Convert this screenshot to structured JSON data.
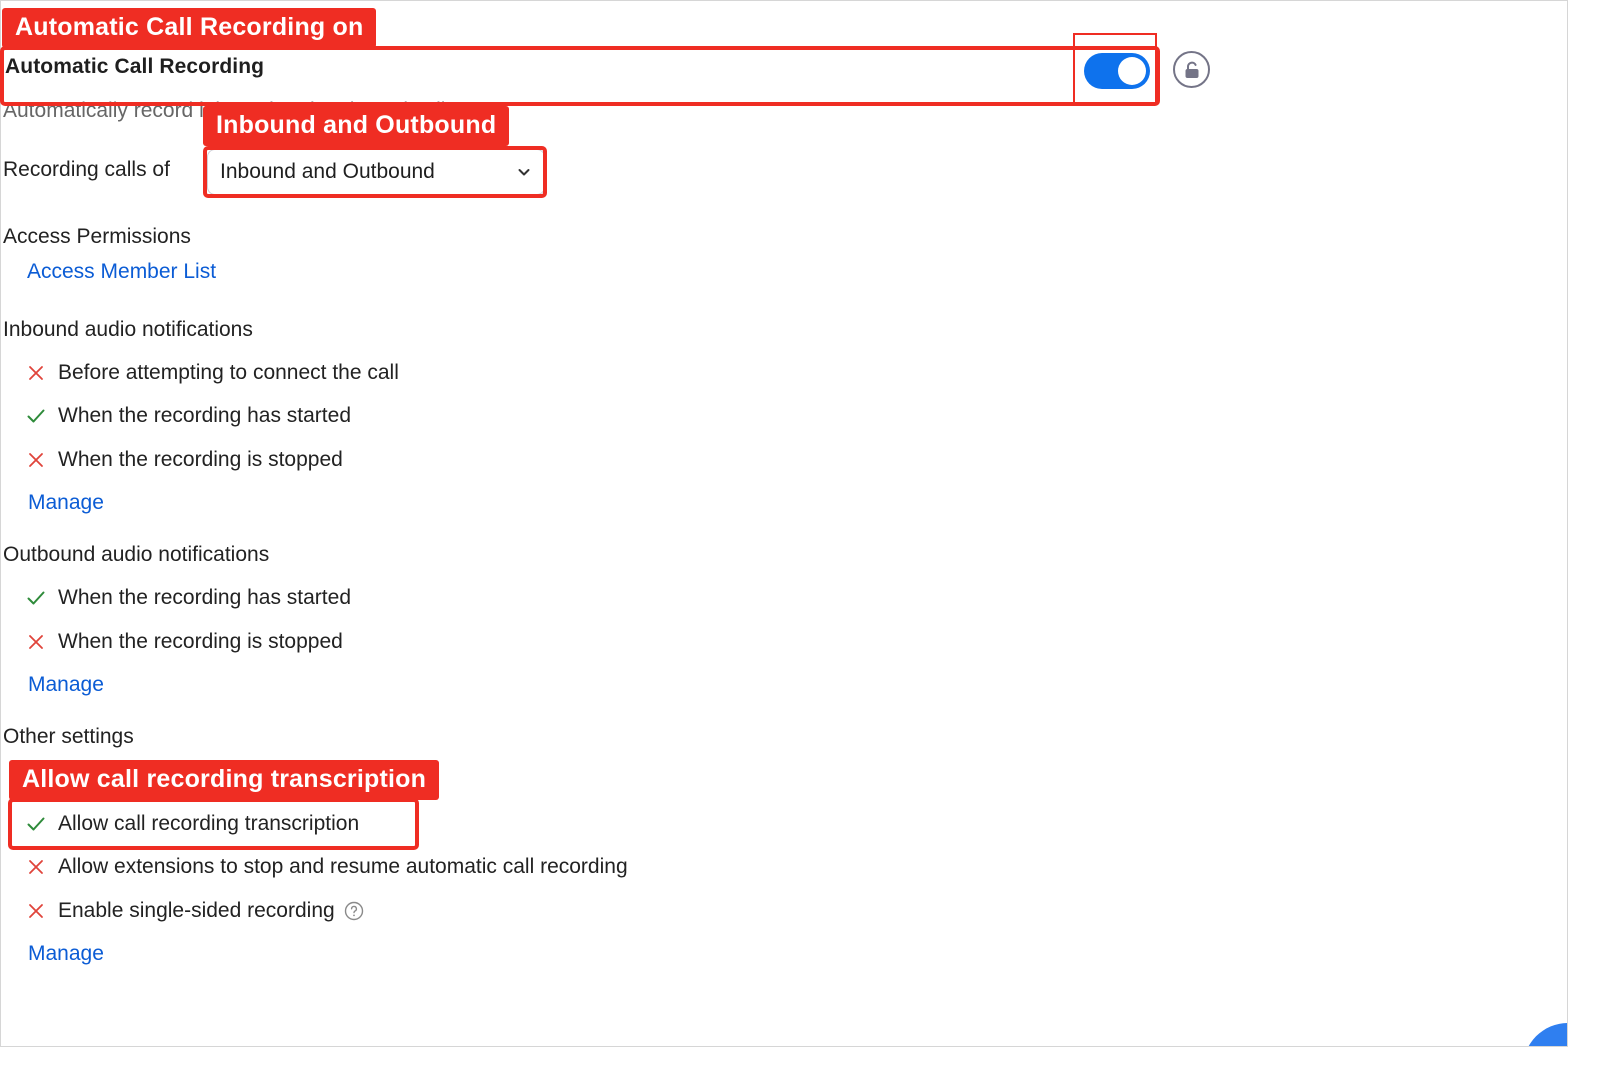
{
  "setting": {
    "title": "Automatic Call Recording",
    "description": "Automatically record inbound and outbound calls",
    "enabled": true
  },
  "recording_calls": {
    "label": "Recording calls of",
    "selected": "Inbound and Outbound"
  },
  "access_permissions": {
    "heading": "Access Permissions",
    "link": "Access Member List"
  },
  "inbound": {
    "heading": "Inbound audio notifications",
    "items": [
      {
        "label": "Before attempting to connect the call",
        "enabled": false
      },
      {
        "label": "When the recording has started",
        "enabled": true
      },
      {
        "label": "When the recording is stopped",
        "enabled": false
      }
    ],
    "manage": "Manage"
  },
  "outbound": {
    "heading": "Outbound audio notifications",
    "items": [
      {
        "label": "When the recording has started",
        "enabled": true
      },
      {
        "label": "When the recording is stopped",
        "enabled": false
      }
    ],
    "manage": "Manage"
  },
  "other": {
    "heading": "Other settings",
    "items": [
      {
        "label": "Allow call recording transcription",
        "enabled": true
      },
      {
        "label": "Allow extensions to stop and resume automatic call recording",
        "enabled": false
      },
      {
        "label": "Enable single-sided recording",
        "enabled": false
      }
    ],
    "manage": "Manage"
  },
  "annotations": {
    "recording_on": "Automatic Call Recording on",
    "inbound_outbound": "Inbound and Outbound",
    "transcription": "Allow call recording transcription"
  },
  "colors": {
    "accent": "#0e72ed",
    "link": "#0b5cd5",
    "check": "#2e8b3a",
    "cross": "#e0443b",
    "annotation": "#ef2d23"
  },
  "icons": {
    "lock": "lock-icon",
    "chevron": "chevron-down-icon",
    "check": "check-icon",
    "cross": "cross-icon",
    "help": "help-icon"
  }
}
